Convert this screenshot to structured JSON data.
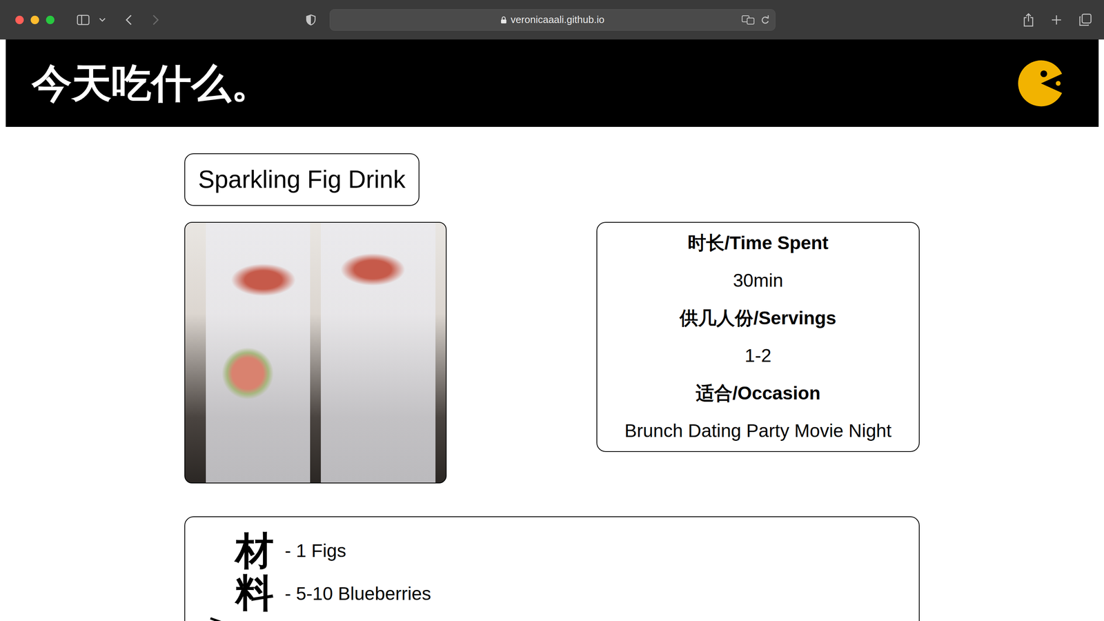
{
  "browser": {
    "url": "veronicaaali.github.io",
    "back_enabled": true,
    "forward_enabled": false
  },
  "site": {
    "logo": "今天吃什么。"
  },
  "recipe": {
    "title": "Sparkling Fig Drink",
    "facts": [
      {
        "label": "时长/Time Spent",
        "value": "30min"
      },
      {
        "label": "供几人份/Servings",
        "value": "1-2"
      },
      {
        "label": "适合/Occasion",
        "value": "Brunch Dating Party Movie Night"
      }
    ],
    "ingredients": {
      "label": "材料",
      "items": [
        "- 1 Figs",
        "- 5-10 Blueberries"
      ]
    }
  }
}
